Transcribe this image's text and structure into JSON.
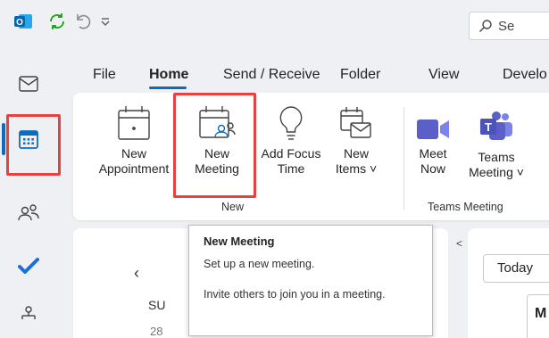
{
  "search": {
    "text": "Se"
  },
  "tabs": [
    {
      "label": "File"
    },
    {
      "label": "Home"
    },
    {
      "label": "Send / Receive"
    },
    {
      "label": "Folder"
    },
    {
      "label": "View"
    },
    {
      "label": "Develo"
    }
  ],
  "ribbon": {
    "new_group": {
      "label": "New",
      "buttons": [
        {
          "line1": "New",
          "line2": "Appointment"
        },
        {
          "line1": "New",
          "line2": "Meeting"
        },
        {
          "line1": "Add Focus",
          "line2": "Time"
        },
        {
          "line1": "New",
          "line2": "Items ˅"
        }
      ]
    },
    "teams_group": {
      "label": "Teams Meeting",
      "buttons": [
        {
          "line1": "Meet",
          "line2": "Now"
        },
        {
          "line1": "Teams",
          "line2": "Meeting ˅"
        }
      ]
    }
  },
  "tooltip": {
    "title": "New Meeting",
    "line1": "Set up a new meeting.",
    "line2": "Invite others to join you in a meeting."
  },
  "calendar": {
    "today_label": "Today",
    "day_header": "SU",
    "date": "28",
    "view_letter": "M"
  },
  "colors": {
    "accent": "#0f6cbd",
    "highlight": "#e94040",
    "teams": "#5b5fc7"
  }
}
